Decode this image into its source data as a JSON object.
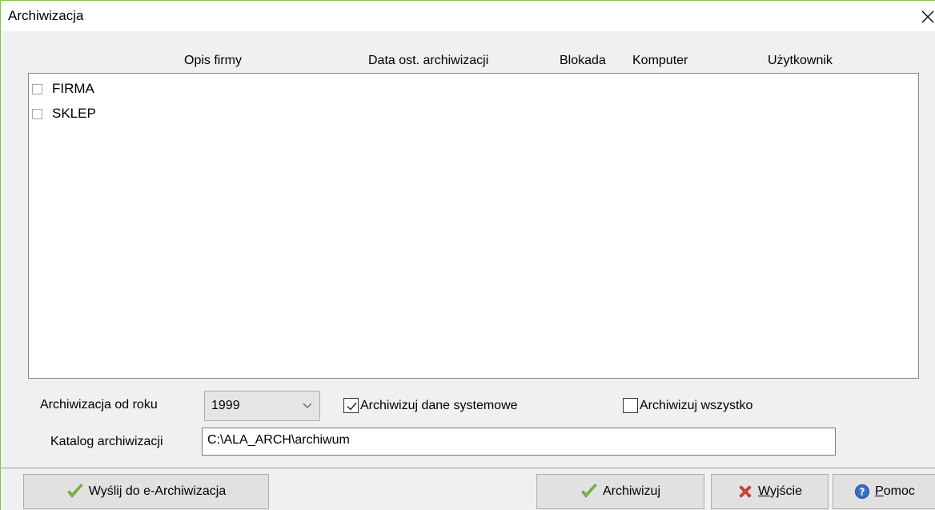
{
  "window": {
    "title": "Archiwizacja"
  },
  "columns": [
    "Opis firmy",
    "Data ost. archiwizacji",
    "Blokada",
    "Komputer",
    "Użytkownik"
  ],
  "companies": [
    {
      "name": "FIRMA",
      "checked": false
    },
    {
      "name": "SKLEP",
      "checked": false
    }
  ],
  "options": {
    "from_year_label": "Archiwizacja od roku",
    "from_year_value": "1999",
    "system_data_label": "Archiwizuj dane systemowe",
    "system_data_checked": true,
    "archive_all_label": "Archiwizuj wszystko",
    "archive_all_checked": false,
    "directory_label": "Katalog archiwizacji",
    "directory_value": "C:\\ALA_ARCH\\archiwum"
  },
  "buttons": {
    "send_e_archive": "Wyślij do e-Archiwizacja",
    "archive": "Archiwizuj",
    "exit_mnemonic": "W",
    "exit_rest": "yjście",
    "help_mnemonic": "P",
    "help_rest": "omoc"
  },
  "colors": {
    "window_border": "#82c341",
    "check_green": "#7cc242",
    "cross_red": "#e8452c",
    "help_blue": "#3a6fc9"
  }
}
